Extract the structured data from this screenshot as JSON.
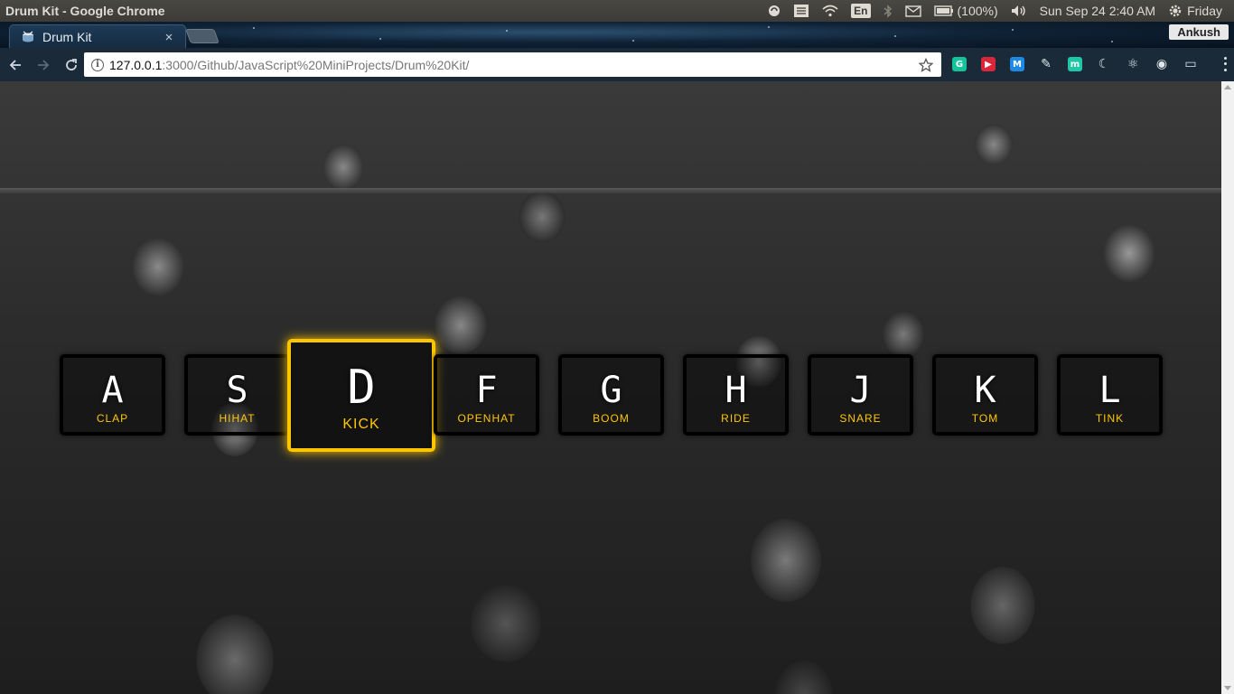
{
  "os_panel": {
    "window_title": "Drum Kit - Google Chrome",
    "language": "En",
    "battery": "(100%)",
    "datetime": "Sun Sep 24  2:40 AM",
    "day": "Friday"
  },
  "browser": {
    "tab": {
      "title": "Drum Kit",
      "close": "×"
    },
    "profile": "Ankush",
    "url_host": "127.0.0.1",
    "url_rest": ":3000/Github/JavaScript%20MiniProjects/Drum%20Kit/",
    "extensions": [
      {
        "name": "grammarly-icon",
        "letter": "G",
        "color": "#15c39a"
      },
      {
        "name": "pocket-style-icon",
        "letter": "▶",
        "color": "#d9263b"
      },
      {
        "name": "m-square-icon",
        "letter": "M",
        "color": "#1e88e5"
      },
      {
        "name": "evernote-icon",
        "letter": "✎",
        "color": "#c8c8c8"
      },
      {
        "name": "m-circle-icon",
        "letter": "m",
        "color": "#1ec7a5"
      },
      {
        "name": "moon-icon",
        "letter": "☾",
        "color": "#c8c8c8"
      },
      {
        "name": "react-icon",
        "letter": "⚛",
        "color": "#c8c8c8"
      },
      {
        "name": "camera-icon",
        "letter": "◉",
        "color": "#c8c8c8"
      },
      {
        "name": "window-icon",
        "letter": "▭",
        "color": "#c8c8c8"
      }
    ]
  },
  "drum_kit": {
    "accent": "#ffc600",
    "active_key": "D",
    "keys": [
      {
        "key": "A",
        "sound": "clap"
      },
      {
        "key": "S",
        "sound": "hihat"
      },
      {
        "key": "D",
        "sound": "kick"
      },
      {
        "key": "F",
        "sound": "openhat"
      },
      {
        "key": "G",
        "sound": "boom"
      },
      {
        "key": "H",
        "sound": "ride"
      },
      {
        "key": "J",
        "sound": "snare"
      },
      {
        "key": "K",
        "sound": "tom"
      },
      {
        "key": "L",
        "sound": "tink"
      }
    ]
  }
}
